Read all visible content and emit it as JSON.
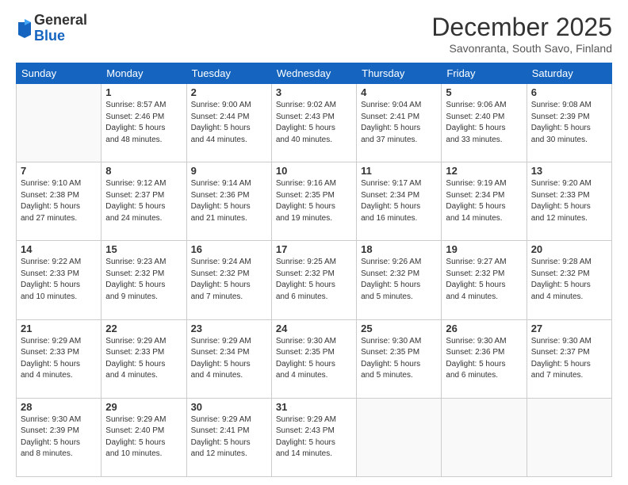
{
  "logo": {
    "general": "General",
    "blue": "Blue"
  },
  "header": {
    "month": "December 2025",
    "location": "Savonranta, South Savo, Finland"
  },
  "weekdays": [
    "Sunday",
    "Monday",
    "Tuesday",
    "Wednesday",
    "Thursday",
    "Friday",
    "Saturday"
  ],
  "weeks": [
    [
      {
        "day": "",
        "info": ""
      },
      {
        "day": "1",
        "info": "Sunrise: 8:57 AM\nSunset: 2:46 PM\nDaylight: 5 hours\nand 48 minutes."
      },
      {
        "day": "2",
        "info": "Sunrise: 9:00 AM\nSunset: 2:44 PM\nDaylight: 5 hours\nand 44 minutes."
      },
      {
        "day": "3",
        "info": "Sunrise: 9:02 AM\nSunset: 2:43 PM\nDaylight: 5 hours\nand 40 minutes."
      },
      {
        "day": "4",
        "info": "Sunrise: 9:04 AM\nSunset: 2:41 PM\nDaylight: 5 hours\nand 37 minutes."
      },
      {
        "day": "5",
        "info": "Sunrise: 9:06 AM\nSunset: 2:40 PM\nDaylight: 5 hours\nand 33 minutes."
      },
      {
        "day": "6",
        "info": "Sunrise: 9:08 AM\nSunset: 2:39 PM\nDaylight: 5 hours\nand 30 minutes."
      }
    ],
    [
      {
        "day": "7",
        "info": "Sunrise: 9:10 AM\nSunset: 2:38 PM\nDaylight: 5 hours\nand 27 minutes."
      },
      {
        "day": "8",
        "info": "Sunrise: 9:12 AM\nSunset: 2:37 PM\nDaylight: 5 hours\nand 24 minutes."
      },
      {
        "day": "9",
        "info": "Sunrise: 9:14 AM\nSunset: 2:36 PM\nDaylight: 5 hours\nand 21 minutes."
      },
      {
        "day": "10",
        "info": "Sunrise: 9:16 AM\nSunset: 2:35 PM\nDaylight: 5 hours\nand 19 minutes."
      },
      {
        "day": "11",
        "info": "Sunrise: 9:17 AM\nSunset: 2:34 PM\nDaylight: 5 hours\nand 16 minutes."
      },
      {
        "day": "12",
        "info": "Sunrise: 9:19 AM\nSunset: 2:34 PM\nDaylight: 5 hours\nand 14 minutes."
      },
      {
        "day": "13",
        "info": "Sunrise: 9:20 AM\nSunset: 2:33 PM\nDaylight: 5 hours\nand 12 minutes."
      }
    ],
    [
      {
        "day": "14",
        "info": "Sunrise: 9:22 AM\nSunset: 2:33 PM\nDaylight: 5 hours\nand 10 minutes."
      },
      {
        "day": "15",
        "info": "Sunrise: 9:23 AM\nSunset: 2:32 PM\nDaylight: 5 hours\nand 9 minutes."
      },
      {
        "day": "16",
        "info": "Sunrise: 9:24 AM\nSunset: 2:32 PM\nDaylight: 5 hours\nand 7 minutes."
      },
      {
        "day": "17",
        "info": "Sunrise: 9:25 AM\nSunset: 2:32 PM\nDaylight: 5 hours\nand 6 minutes."
      },
      {
        "day": "18",
        "info": "Sunrise: 9:26 AM\nSunset: 2:32 PM\nDaylight: 5 hours\nand 5 minutes."
      },
      {
        "day": "19",
        "info": "Sunrise: 9:27 AM\nSunset: 2:32 PM\nDaylight: 5 hours\nand 4 minutes."
      },
      {
        "day": "20",
        "info": "Sunrise: 9:28 AM\nSunset: 2:32 PM\nDaylight: 5 hours\nand 4 minutes."
      }
    ],
    [
      {
        "day": "21",
        "info": "Sunrise: 9:29 AM\nSunset: 2:33 PM\nDaylight: 5 hours\nand 4 minutes."
      },
      {
        "day": "22",
        "info": "Sunrise: 9:29 AM\nSunset: 2:33 PM\nDaylight: 5 hours\nand 4 minutes."
      },
      {
        "day": "23",
        "info": "Sunrise: 9:29 AM\nSunset: 2:34 PM\nDaylight: 5 hours\nand 4 minutes."
      },
      {
        "day": "24",
        "info": "Sunrise: 9:30 AM\nSunset: 2:35 PM\nDaylight: 5 hours\nand 4 minutes."
      },
      {
        "day": "25",
        "info": "Sunrise: 9:30 AM\nSunset: 2:35 PM\nDaylight: 5 hours\nand 5 minutes."
      },
      {
        "day": "26",
        "info": "Sunrise: 9:30 AM\nSunset: 2:36 PM\nDaylight: 5 hours\nand 6 minutes."
      },
      {
        "day": "27",
        "info": "Sunrise: 9:30 AM\nSunset: 2:37 PM\nDaylight: 5 hours\nand 7 minutes."
      }
    ],
    [
      {
        "day": "28",
        "info": "Sunrise: 9:30 AM\nSunset: 2:39 PM\nDaylight: 5 hours\nand 8 minutes."
      },
      {
        "day": "29",
        "info": "Sunrise: 9:29 AM\nSunset: 2:40 PM\nDaylight: 5 hours\nand 10 minutes."
      },
      {
        "day": "30",
        "info": "Sunrise: 9:29 AM\nSunset: 2:41 PM\nDaylight: 5 hours\nand 12 minutes."
      },
      {
        "day": "31",
        "info": "Sunrise: 9:29 AM\nSunset: 2:43 PM\nDaylight: 5 hours\nand 14 minutes."
      },
      {
        "day": "",
        "info": ""
      },
      {
        "day": "",
        "info": ""
      },
      {
        "day": "",
        "info": ""
      }
    ]
  ]
}
